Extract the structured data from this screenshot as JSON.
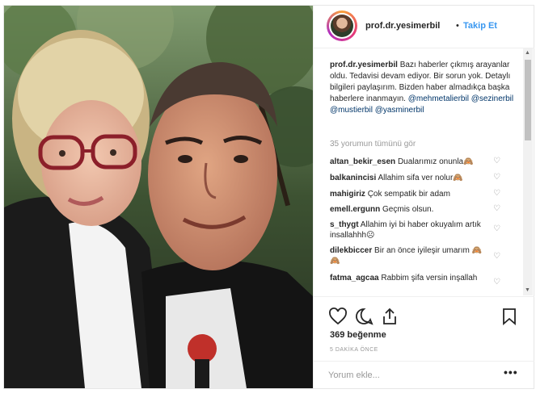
{
  "header": {
    "username": "prof.dr.yesimerbil",
    "separator": "•",
    "follow_label": "Takip Et"
  },
  "caption": {
    "username": "prof.dr.yesimerbil",
    "text": "Bazı haberler çıkmış arayanlar oldu. Tedavisi devam ediyor. Bir sorun yok. Detaylı bilgileri paylaşırım. Bizden haber almadıkça başka haberlere inanmayın.",
    "mentions": [
      "@mehmetalierbil",
      "@sezinerbil",
      "@mustierbil",
      "@yasminerbil"
    ]
  },
  "view_all": "35 yorumun tümünü gör",
  "comments": [
    {
      "username": "altan_bekir_esen",
      "text": "Dualarımız onunla🙈"
    },
    {
      "username": "balkanincisi",
      "text": "Allahim sifa ver nolur🙈"
    },
    {
      "username": "mahigiriz",
      "text": "Çok sempatik bir adam"
    },
    {
      "username": "emell.ergunn",
      "text": "Geçmis olsun."
    },
    {
      "username": "s_thygt",
      "text": "Allahim iyi bi haber okuyalım artık insallahhh☹"
    },
    {
      "username": "dilekbiccer",
      "text": "Bir an önce iyileşir umarım 🙈🙈"
    },
    {
      "username": "fatma_agcaa",
      "text": "Rabbim şifa versin inşallah"
    }
  ],
  "likes": "369 beğenme",
  "time": "5 DAKİKA ÖNCE",
  "add_comment": {
    "placeholder": "Yorum ekle..."
  },
  "more_label": "•••",
  "icons": {
    "like": "heart-icon",
    "comment": "comment-icon",
    "share": "share-icon",
    "save": "bookmark-icon"
  }
}
